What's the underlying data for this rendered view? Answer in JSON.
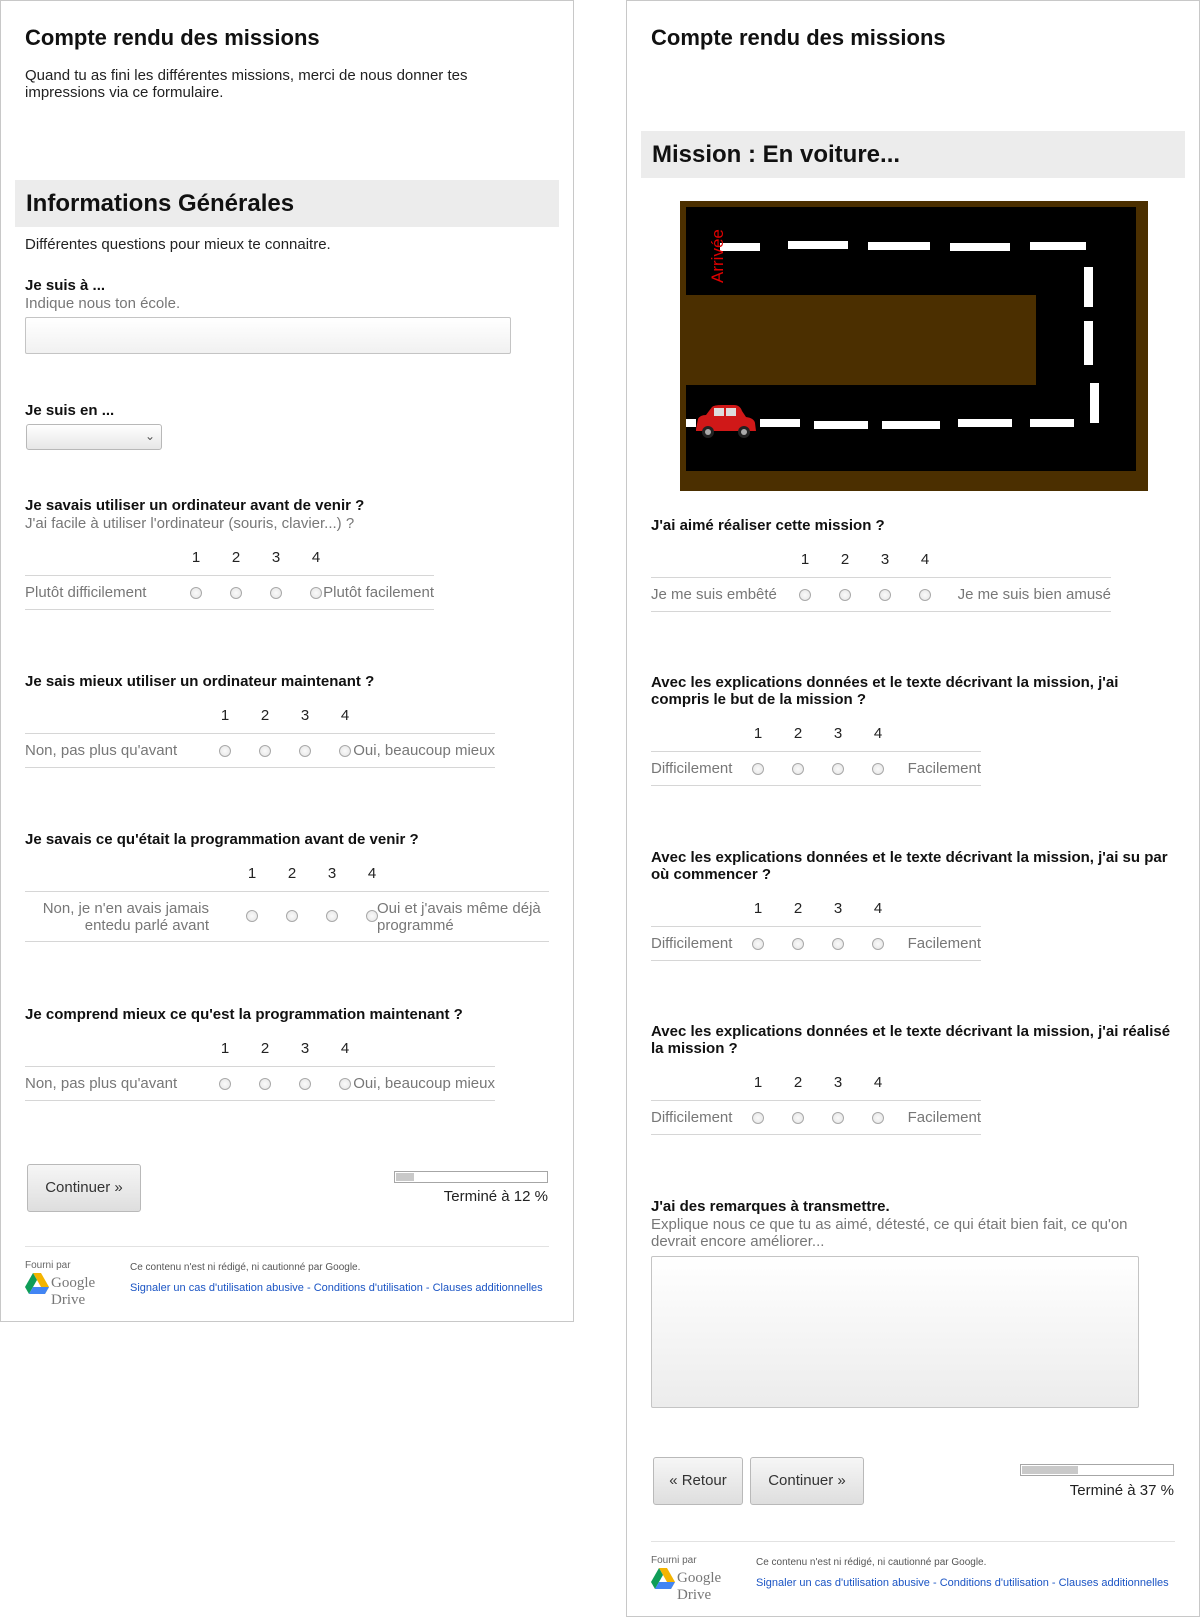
{
  "left": {
    "form_title": "Compte rendu des missions",
    "form_description": "Quand tu as fini les différentes missions, merci de nous donner tes impressions via ce formulaire.",
    "section_title": "Informations Générales",
    "section_description": "Différentes questions pour mieux te connaitre.",
    "q_school": {
      "title": "Je suis à ...",
      "help": "Indique nous ton école.",
      "value": ""
    },
    "q_class": {
      "title": "Je suis en ...",
      "selected": ""
    },
    "scales": [
      {
        "title": "Je savais utiliser un ordinateur avant de venir ?",
        "help": "J'ai facile à utiliser l'ordinateur (souris, clavier...) ?",
        "numbers": [
          "1",
          "2",
          "3",
          "4"
        ],
        "min_label": "Plutôt difficilement",
        "max_label": "Plutôt facilement"
      },
      {
        "title": "Je sais mieux utiliser un ordinateur maintenant ?",
        "numbers": [
          "1",
          "2",
          "3",
          "4"
        ],
        "min_label": "Non, pas plus qu'avant",
        "max_label": "Oui, beaucoup mieux"
      },
      {
        "title": "Je savais ce qu'était la programmation avant de venir ?",
        "numbers": [
          "1",
          "2",
          "3",
          "4"
        ],
        "min_label": "Non, je n'en avais jamais entedu parlé avant",
        "max_label": "Oui et j'avais même déjà programmé"
      },
      {
        "title": "Je comprend mieux ce qu'est la programmation maintenant ?",
        "numbers": [
          "1",
          "2",
          "3",
          "4"
        ],
        "min_label": "Non, pas plus qu'avant",
        "max_label": "Oui, beaucoup mieux"
      }
    ],
    "continue_label": "Continuer »",
    "progress": {
      "text": "Terminé à 12 %",
      "fraction": 0.12
    },
    "footer": {
      "powered_by": "Fourni par",
      "drive_word": "Google Drive",
      "note": "Ce contenu n'est ni rédigé, ni cautionné par Google.",
      "links": "Signaler un cas d'utilisation abusive - Conditions d'utilisation - Clauses additionnelles"
    }
  },
  "right": {
    "form_title": "Compte rendu des missions",
    "section_title": "Mission : En voiture...",
    "image": {
      "label": "Arrivée",
      "road_color": "#000000",
      "ground_color": "#4b2f00",
      "car_color": "#d01818"
    },
    "scales": [
      {
        "title": "J'ai aimé réaliser cette mission ?",
        "numbers": [
          "1",
          "2",
          "3",
          "4"
        ],
        "min_label": "Je me suis embêté",
        "max_label": "Je me suis bien amusé"
      },
      {
        "title": "Avec les explications données et le texte décrivant la mission, j'ai compris le but de la mission ?",
        "numbers": [
          "1",
          "2",
          "3",
          "4"
        ],
        "min_label": "Difficilement",
        "max_label": "Facilement"
      },
      {
        "title": "Avec les explications données et le texte décrivant la mission, j'ai su par où commencer ?",
        "numbers": [
          "1",
          "2",
          "3",
          "4"
        ],
        "min_label": "Difficilement",
        "max_label": "Facilement"
      },
      {
        "title": "Avec les explications données et le texte décrivant la mission, j'ai réalisé la mission ?",
        "numbers": [
          "1",
          "2",
          "3",
          "4"
        ],
        "min_label": "Difficilement",
        "max_label": "Facilement"
      }
    ],
    "remarks": {
      "title": "J'ai des remarques à transmettre.",
      "help": "Explique nous ce que tu as aimé, détesté, ce qui était bien fait, ce qu'on devrait encore améliorer...",
      "value": ""
    },
    "back_label": "« Retour",
    "continue_label": "Continuer »",
    "progress": {
      "text": "Terminé à 37 %",
      "fraction": 0.37
    },
    "footer": {
      "powered_by": "Fourni par",
      "drive_word": "Google Drive",
      "note": "Ce contenu n'est ni rédigé, ni cautionné par Google.",
      "links": "Signaler un cas d'utilisation abusive - Conditions d'utilisation - Clauses additionnelles"
    }
  }
}
